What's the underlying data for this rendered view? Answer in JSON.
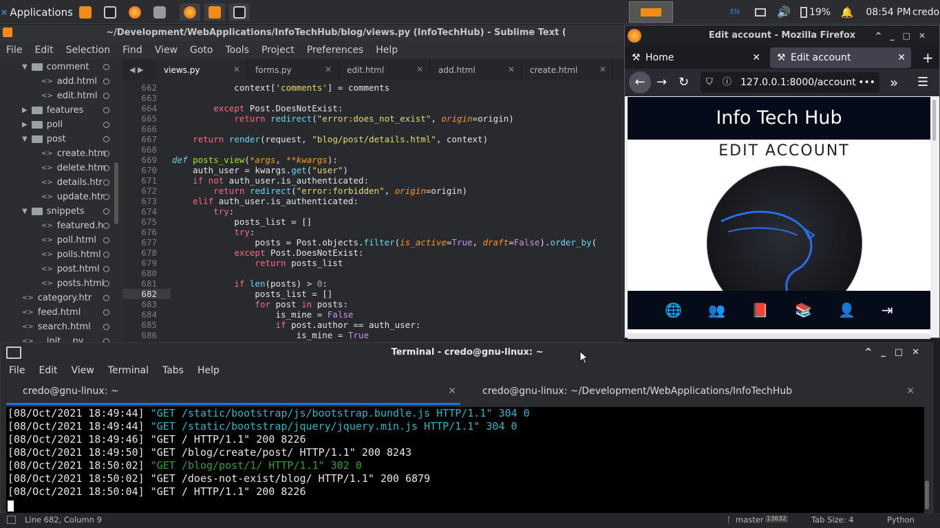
{
  "taskbar": {
    "applications_label": "Applications",
    "battery": "19%",
    "clock": "08:54 PM",
    "user": "credo",
    "keyboard_layout": "EN"
  },
  "sublime": {
    "title": "~/Development/WebApplications/InfoTechHub/blog/views.py (InfoTechHub) - Sublime Text (",
    "menu": [
      "File",
      "Edit",
      "Selection",
      "Find",
      "View",
      "Goto",
      "Tools",
      "Project",
      "Preferences",
      "Help"
    ],
    "sidebar": [
      {
        "label": "comment",
        "type": "folder-open",
        "indent": 1
      },
      {
        "label": "add.html",
        "type": "file",
        "indent": 2
      },
      {
        "label": "edit.html",
        "type": "file",
        "indent": 2
      },
      {
        "label": "features",
        "type": "folder",
        "indent": 1
      },
      {
        "label": "poll",
        "type": "folder",
        "indent": 1
      },
      {
        "label": "post",
        "type": "folder-open",
        "indent": 1
      },
      {
        "label": "create.htm",
        "type": "file",
        "indent": 2
      },
      {
        "label": "delete.htm",
        "type": "file",
        "indent": 2
      },
      {
        "label": "details.htr",
        "type": "file",
        "indent": 2
      },
      {
        "label": "update.htr",
        "type": "file",
        "indent": 2
      },
      {
        "label": "snippets",
        "type": "folder-open",
        "indent": 1
      },
      {
        "label": "featured.h",
        "type": "file",
        "indent": 2
      },
      {
        "label": "poll.html",
        "type": "file",
        "indent": 2
      },
      {
        "label": "polls.html",
        "type": "file",
        "indent": 2
      },
      {
        "label": "post.html",
        "type": "file",
        "indent": 2
      },
      {
        "label": "posts.html",
        "type": "file",
        "indent": 2
      },
      {
        "label": "category.htr",
        "type": "file",
        "indent": 1
      },
      {
        "label": "feed.html",
        "type": "file",
        "indent": 1
      },
      {
        "label": "search.html",
        "type": "file",
        "indent": 1
      },
      {
        "label": "__init__.py",
        "type": "file",
        "indent": 1
      }
    ],
    "tabs": [
      "views.py",
      "forms.py",
      "edit.html",
      "add.html",
      "create.html"
    ],
    "active_tab": "views.py",
    "line_numbers": [
      "662",
      "663",
      "664",
      "665",
      "666",
      "667",
      "668",
      "669",
      "670",
      "671",
      "672",
      "673",
      "674",
      "675",
      "676",
      "677",
      "678",
      "679",
      "680",
      "681",
      "682",
      "683",
      "684",
      "685",
      "686"
    ],
    "current_line": "682",
    "status": {
      "position": "Line 682, Column 9",
      "branch": "master",
      "changes": "13632",
      "tab_size": "Tab Size: 4",
      "syntax": "Python"
    }
  },
  "firefox": {
    "title": "Edit account - Mozilla Firefox",
    "tabs": [
      "Home",
      "Edit account"
    ],
    "url": "127.0.0.1:8000/account/",
    "site_title": "Info Tech Hub",
    "page_heading": "EDIT ACCOUNT"
  },
  "terminal": {
    "title": "Terminal - credo@gnu-linux: ~",
    "menu": [
      "File",
      "Edit",
      "View",
      "Terminal",
      "Tabs",
      "Help"
    ],
    "tabs": [
      "credo@gnu-linux: ~",
      "credo@gnu-linux: ~/Development/WebApplications/InfoTechHub"
    ],
    "lines": [
      {
        "ts": "[08/Oct/2021 18:49:44]",
        "req": "\"GET /static/bootstrap/js/bootstrap.bundle.js HTTP/1.1\" 304 0",
        "color": "cyan"
      },
      {
        "ts": "[08/Oct/2021 18:49:44]",
        "req": "\"GET /static/bootstrap/jquery/jquery.min.js HTTP/1.1\" 304 0",
        "color": "cyan"
      },
      {
        "ts": "[08/Oct/2021 18:49:46]",
        "req": "\"GET / HTTP/1.1\" 200 8226",
        "color": "white"
      },
      {
        "ts": "[08/Oct/2021 18:49:50]",
        "req": "\"GET /blog/create/post/ HTTP/1.1\" 200 8243",
        "color": "white"
      },
      {
        "ts": "[08/Oct/2021 18:50:02]",
        "req": "\"GET /blog/post/1/ HTTP/1.1\" 302 0",
        "color": "green"
      },
      {
        "ts": "[08/Oct/2021 18:50:02]",
        "req": "\"GET /does-not-exist/blog/ HTTP/1.1\" 200 6879",
        "color": "white"
      },
      {
        "ts": "[08/Oct/2021 18:50:04]",
        "req": "\"GET / HTTP/1.1\" 200 8226",
        "color": "white"
      }
    ]
  },
  "colors": {
    "accent_blue": "#1a73e8",
    "log_cyan": "#2ab7c9",
    "log_green": "#2aa52a"
  }
}
